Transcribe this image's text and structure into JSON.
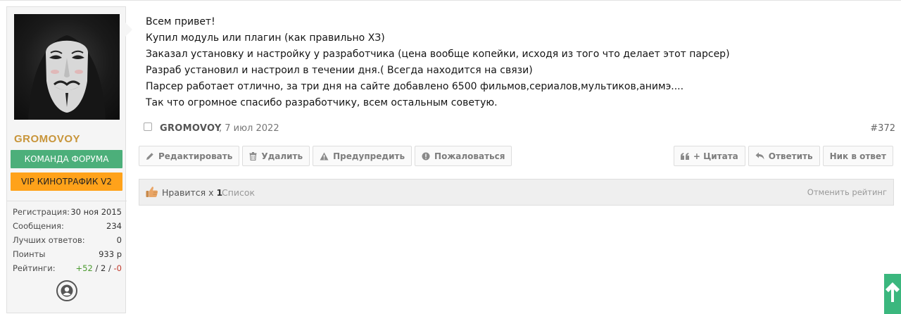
{
  "user": {
    "username": "GROMOVOY",
    "badge_team": "КОМАНДА ФОРУМА",
    "badge_vip": "VIP КИНОТРАФИК V2",
    "stats": [
      {
        "label": "Регистрация:",
        "value": "30 ноя 2015"
      },
      {
        "label": "Сообщения:",
        "value": "234"
      },
      {
        "label": "Лучших ответов:",
        "value": "0"
      },
      {
        "label": "Поинты",
        "value": "933 р"
      }
    ],
    "ratings_label": "Рейтинги:",
    "ratings_pos": "+52",
    "ratings_sep1": " / ",
    "ratings_neutral": "2",
    "ratings_sep2": " / ",
    "ratings_neg": "-0"
  },
  "message": {
    "lines": [
      "Всем привет!",
      "Купил модуль или плагин (как правильно ХЗ)",
      "Заказал установку и настройку у разработчика (цена вообще копейки, исходя из того что делает этот парсер)",
      "Разраб установил и настроил в течении дня.( Всегда находится на связи)",
      "Парсер работает отлично, за три дня на сайте добавлено 6500 фильмов,сериалов,мультиков,анимэ....",
      "Так что огромное спасибо разработчику, всем остальным советую."
    ]
  },
  "meta": {
    "author": "GROMOVOY",
    "date": ", 7 июл 2022",
    "permalink": "#372"
  },
  "actions": {
    "edit": "Редактировать",
    "delete": "Удалить",
    "warn": "Предупредить",
    "report": "Пожаловаться",
    "quote": "+ Цитата",
    "reply": "Ответить",
    "nick": "Ник в ответ"
  },
  "likes": {
    "label": "Нравится x",
    "count": "1",
    "list": "Список",
    "cancel": "Отменить рейтинг"
  },
  "colors": {
    "username": "#c8953a",
    "badge_team": "#4caf7a",
    "badge_vip": "#ffa21a",
    "scroll_top": "#3bb77e"
  },
  "icons": {
    "avatar": "guy-fawkes-mask",
    "profile": "user-circle-icon",
    "edit": "pencil-icon",
    "delete": "trash-icon",
    "warn": "warning-triangle-icon",
    "report": "exclamation-circle-icon",
    "quote": "quote-icon",
    "reply": "reply-arrow-icon",
    "like": "thumbs-up-icon",
    "scroll": "arrow-up-icon"
  }
}
